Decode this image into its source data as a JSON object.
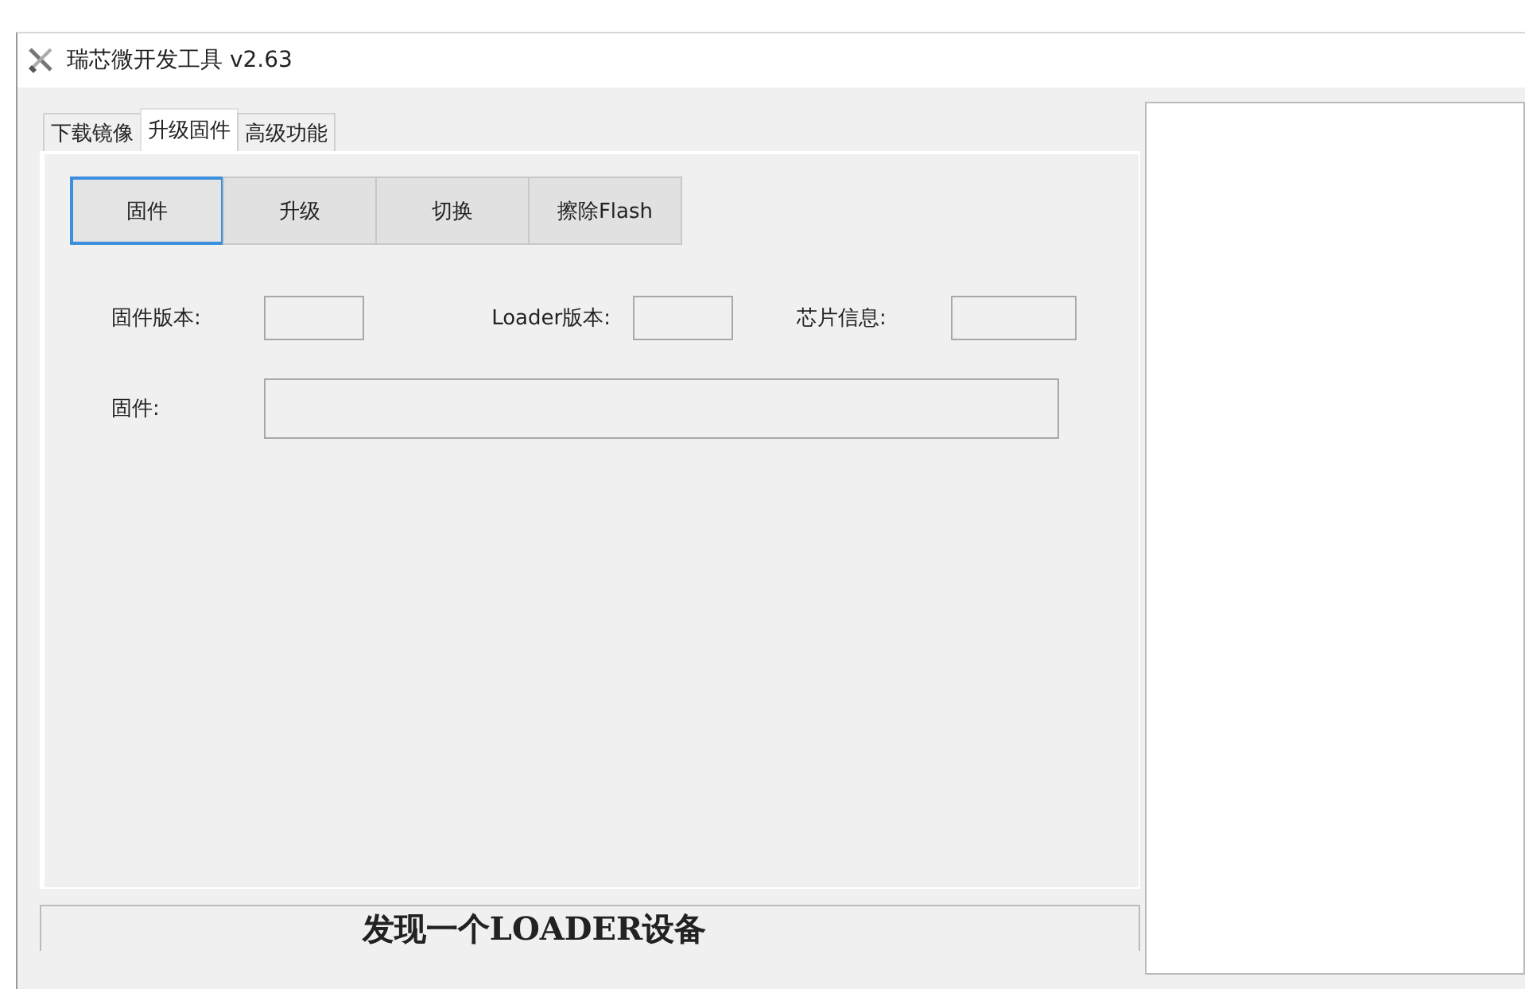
{
  "window": {
    "title": "瑞芯微开发工具 v2.63"
  },
  "tabs": [
    {
      "label": "下载镜像",
      "selected": false
    },
    {
      "label": "升级固件",
      "selected": true
    },
    {
      "label": "高级功能",
      "selected": false
    }
  ],
  "buttons": [
    {
      "label": "固件",
      "selected": true
    },
    {
      "label": "升级",
      "selected": false
    },
    {
      "label": "切换",
      "selected": false
    },
    {
      "label": "擦除Flash",
      "selected": false
    }
  ],
  "info_fields": [
    {
      "label": "固件版本:"
    },
    {
      "label": "Loader版本:"
    },
    {
      "label": "芯片信息:"
    }
  ],
  "firmware_field": {
    "label": "固件:"
  },
  "status_bar": "发现一个LOADER设备"
}
